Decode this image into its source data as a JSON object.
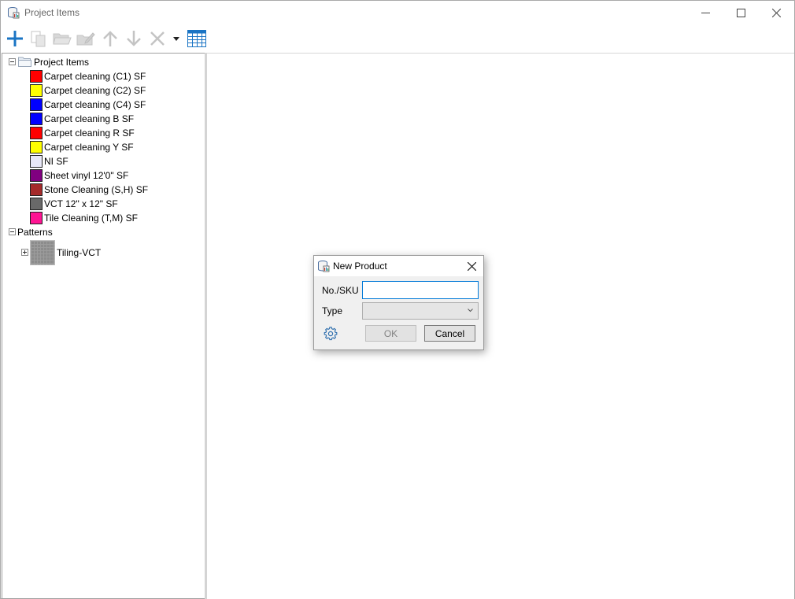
{
  "window": {
    "title": "Project Items"
  },
  "toolbar": {
    "buttons": [
      {
        "name": "add",
        "icon": "plus-icon",
        "enabled": true
      },
      {
        "name": "copy",
        "icon": "copy-icon",
        "enabled": false
      },
      {
        "name": "open",
        "icon": "folder-open-icon",
        "enabled": false
      },
      {
        "name": "edit",
        "icon": "edit-icon",
        "enabled": false
      },
      {
        "name": "move-up",
        "icon": "arrow-up-icon",
        "enabled": false
      },
      {
        "name": "move-down",
        "icon": "arrow-down-icon",
        "enabled": false
      },
      {
        "name": "delete",
        "icon": "delete-x-icon",
        "enabled": false
      },
      {
        "name": "dropdown",
        "icon": "caret-down-icon",
        "enabled": true
      },
      {
        "name": "grid-view",
        "icon": "grid-icon",
        "enabled": true
      }
    ]
  },
  "tree": {
    "root_label": "Project Items",
    "items": [
      {
        "label": "Carpet cleaning (C1)  SF",
        "color": "#ff0000"
      },
      {
        "label": "Carpet cleaning (C2)  SF",
        "color": "#ffff00"
      },
      {
        "label": "Carpet cleaning (C4)  SF",
        "color": "#0000ff"
      },
      {
        "label": "Carpet cleaning B  SF",
        "color": "#0000ff"
      },
      {
        "label": "Carpet cleaning R  SF",
        "color": "#ff0000"
      },
      {
        "label": "Carpet cleaning Y  SF",
        "color": "#ffff00"
      },
      {
        "label": "NI  SF",
        "color": "#e8e8f8"
      },
      {
        "label": "Sheet vinyl 12'0\" SF",
        "color": "#800080"
      },
      {
        "label": "Stone Cleaning (S,H)  SF",
        "color": "#a52a2a"
      },
      {
        "label": "VCT 12\" x 12\" SF",
        "color": "#696969"
      },
      {
        "label": "Tile Cleaning (T,M)  SF",
        "color": "#ff1493"
      }
    ],
    "patterns_label": "Patterns",
    "patterns": [
      {
        "label": "Tiling-VCT"
      }
    ]
  },
  "dialog": {
    "title": "New Product",
    "sku_label": "No./SKU",
    "sku_value": "",
    "type_label": "Type",
    "type_value": "",
    "ok_label": "OK",
    "cancel_label": "Cancel",
    "ok_enabled": false
  },
  "colors": {
    "accent": "#0078d7",
    "icon_blue": "#1a74c4",
    "disabled_icon": "#c4c4c4"
  }
}
